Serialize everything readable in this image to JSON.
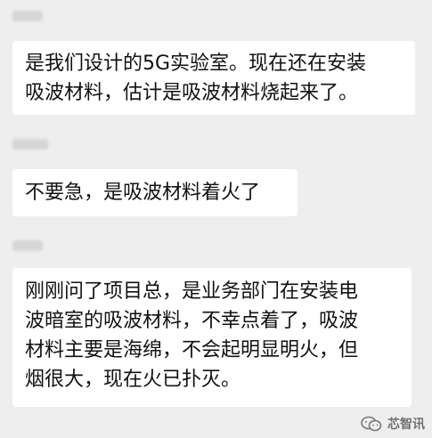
{
  "messages": [
    {
      "text": "是我们设计的5G实验室。现在还在安装\n吸波材料，估计是吸波材料烧起来了。"
    },
    {
      "text": "不要急，是吸波材料着火了"
    },
    {
      "text": "刚刚问了项目总，是业务部门在安装电\n波暗室的吸波材料，不幸点着了，吸波\n材料主要是海绵，不会起明显明火，但\n烟很大，现在火已扑灭。"
    }
  ],
  "watermark": {
    "icon": "wechat-icon",
    "text": "芯智讯"
  },
  "colors": {
    "background": "#eeeeee",
    "bubble": "#ffffff",
    "text": "#111111",
    "watermark": "#6f6f6f"
  }
}
